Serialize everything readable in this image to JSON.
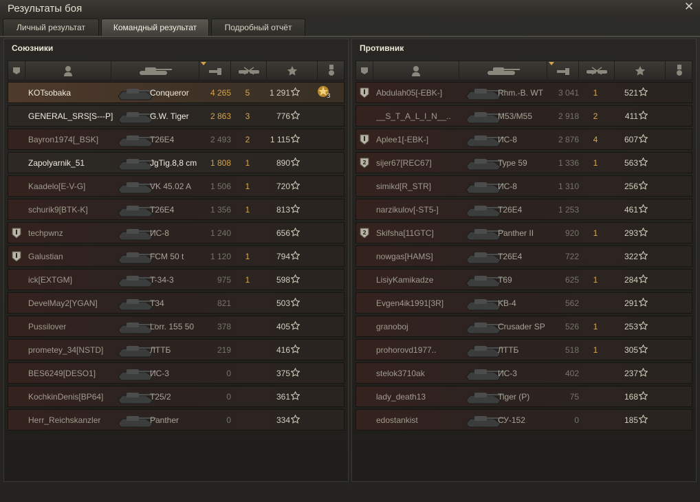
{
  "window": {
    "title": "Результаты боя",
    "close_label": "✕"
  },
  "tabs": [
    {
      "label": "Личный результат",
      "active": false
    },
    {
      "label": "Командный результат",
      "active": true
    },
    {
      "label": "Подробный отчёт",
      "active": false
    }
  ],
  "columns": [
    "squad-icon",
    "player-icon",
    "tank-icon",
    "damage-icon",
    "kills-icon",
    "xp-star-icon",
    "medal-icon"
  ],
  "sort_indicator": "chevron-down-icon",
  "allies": {
    "title": "Союзники",
    "rows": [
      {
        "name": "KOTsobaka",
        "tank": "Conqueror",
        "damage": "4 265",
        "kills": "5",
        "xp": "1 291",
        "squad": "",
        "medal": "3"
      },
      {
        "name": "GENERAL_SRS[S---P]",
        "tank": "G.W. Tiger",
        "damage": "2 863",
        "kills": "3",
        "xp": "776",
        "squad": ""
      },
      {
        "name": "Bayron1974[_BSK]",
        "tank": "T26E4",
        "damage": "2 493",
        "kills": "2",
        "xp": "1 115",
        "squad": ""
      },
      {
        "name": "Zapolyarnik_51",
        "tank": "JgTig.8,8 cm",
        "damage": "1 808",
        "kills": "1",
        "xp": "890",
        "squad": ""
      },
      {
        "name": "Kaadelo[E-V-G]",
        "tank": "VK 45.02 A",
        "damage": "1 506",
        "kills": "1",
        "xp": "720",
        "squad": ""
      },
      {
        "name": "schurik9[BTK-K]",
        "tank": "T26E4",
        "damage": "1 356",
        "kills": "1",
        "xp": "813",
        "squad": ""
      },
      {
        "name": "techpwnz",
        "tank": "ИС-8",
        "damage": "1 240",
        "kills": "",
        "xp": "656",
        "squad": "1"
      },
      {
        "name": "Galustian",
        "tank": "FCM 50 t",
        "damage": "1 120",
        "kills": "1",
        "xp": "794",
        "squad": "1"
      },
      {
        "name": "ick[EXTGM]",
        "tank": "T-34-3",
        "damage": "975",
        "kills": "1",
        "xp": "598",
        "squad": ""
      },
      {
        "name": "DevelMay2[YGAN]",
        "tank": "T34",
        "damage": "821",
        "kills": "",
        "xp": "503",
        "squad": ""
      },
      {
        "name": "Pussilover",
        "tank": "Lorr. 155 50",
        "damage": "378",
        "kills": "",
        "xp": "405",
        "squad": ""
      },
      {
        "name": "prometey_34[NSTD]",
        "tank": "ЛТТБ",
        "damage": "219",
        "kills": "",
        "xp": "416",
        "squad": ""
      },
      {
        "name": "BES6249[DESO1]",
        "tank": "ИС-3",
        "damage": "0",
        "kills": "",
        "xp": "375",
        "squad": ""
      },
      {
        "name": "KochkinDenis[BP64]",
        "tank": "T25/2",
        "damage": "0",
        "kills": "",
        "xp": "361",
        "squad": ""
      },
      {
        "name": "Herr_Reichskanzler",
        "tank": "Panther",
        "damage": "0",
        "kills": "",
        "xp": "334",
        "squad": ""
      }
    ]
  },
  "enemies": {
    "title": "Противник",
    "rows": [
      {
        "name": "Abdulah05[-EBK-]",
        "tank": "Rhm.-B. WT",
        "damage": "3 041",
        "kills": "1",
        "xp": "521",
        "squad": "1"
      },
      {
        "name": "__S_T_A_L_I_N__..",
        "tank": "M53/M55",
        "damage": "2 918",
        "kills": "2",
        "xp": "411",
        "squad": ""
      },
      {
        "name": "Aplee1[-EBK-]",
        "tank": "ИС-8",
        "damage": "2 876",
        "kills": "4",
        "xp": "607",
        "squad": "1"
      },
      {
        "name": "sijer67[REC67]",
        "tank": "Type 59",
        "damage": "1 336",
        "kills": "1",
        "xp": "563",
        "squad": "2"
      },
      {
        "name": "simikd[R_STR]",
        "tank": "ИС-8",
        "damage": "1 310",
        "kills": "",
        "xp": "256",
        "squad": ""
      },
      {
        "name": "narzikulov[-ST5-]",
        "tank": "T26E4",
        "damage": "1 253",
        "kills": "",
        "xp": "461",
        "squad": ""
      },
      {
        "name": "Skifsha[11GTC]",
        "tank": "Panther II",
        "damage": "920",
        "kills": "1",
        "xp": "293",
        "squad": "2"
      },
      {
        "name": "nowgas[HAMS]",
        "tank": "T26E4",
        "damage": "722",
        "kills": "",
        "xp": "322",
        "squad": ""
      },
      {
        "name": "LisiyKamikadze",
        "tank": "T69",
        "damage": "625",
        "kills": "1",
        "xp": "284",
        "squad": ""
      },
      {
        "name": "Evgen4ik1991[3R]",
        "tank": "KB-4",
        "damage": "562",
        "kills": "",
        "xp": "291",
        "squad": ""
      },
      {
        "name": "granoboj",
        "tank": "Crusader SP",
        "damage": "526",
        "kills": "1",
        "xp": "253",
        "squad": ""
      },
      {
        "name": "prohorovd1977..",
        "tank": "ЛТТБ",
        "damage": "518",
        "kills": "1",
        "xp": "305",
        "squad": ""
      },
      {
        "name": "stelok3710ak",
        "tank": "ИС-3",
        "damage": "402",
        "kills": "",
        "xp": "237",
        "squad": ""
      },
      {
        "name": "lady_death13",
        "tank": "Tiger (P)",
        "damage": "75",
        "kills": "",
        "xp": "168",
        "squad": ""
      },
      {
        "name": "edostankist",
        "tank": "СУ-152",
        "damage": "0",
        "kills": "",
        "xp": "185",
        "squad": ""
      }
    ]
  }
}
